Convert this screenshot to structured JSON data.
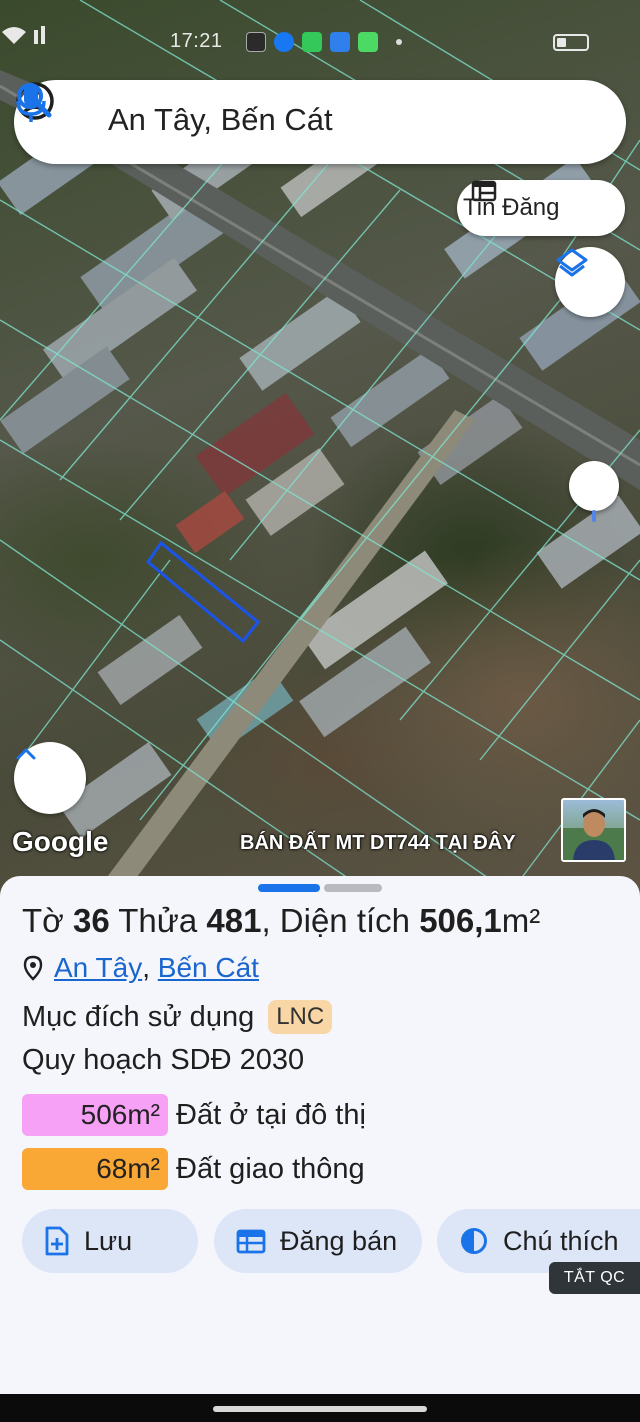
{
  "status_bar": {
    "time": "17:21",
    "app_icon_colors": [
      "#2b2b2b",
      "#1877f2",
      "#34c759",
      "#2f80ed",
      "#4cd964"
    ]
  },
  "search": {
    "query": "An Tây, Bến Cát"
  },
  "map": {
    "tin_dang_label": "Tin Đăng",
    "google_label": "Google",
    "ad_text": "BÁN ĐẤT  MT DT744 TẠI ĐÂY",
    "highlight_color": "#1a55e8",
    "parcel_line_color": "#7fe6d0"
  },
  "sheet": {
    "title_prefix": "Tờ ",
    "sheet_number": "36",
    "title_mid": " Thửa ",
    "parcel_number": "481",
    "title_area_prefix": ", Diện tích ",
    "area": "506,1",
    "area_unit": "m²",
    "location": {
      "ward": "An Tây",
      "separator": ", ",
      "district": "Bến Cát"
    },
    "purpose_label": "Mục đích sử dụng",
    "purpose_code": "LNC",
    "plan_title": "Quy hoạch SDĐ 2030",
    "plans": [
      {
        "area": "506m²",
        "label": "Đất ở tại đô thị",
        "color": "#f6a1f6"
      },
      {
        "area": "68m²",
        "label": "Đất giao thông",
        "color": "#f9a735"
      }
    ],
    "actions": {
      "save": "Lưu",
      "sell": "Đăng bán",
      "legend": "Chú thích"
    }
  },
  "ad_close_label": "TẮT QC",
  "colors": {
    "accent": "#1a73e8",
    "action_bg": "#dde6f7",
    "sheet_bg": "#f5f6fb"
  }
}
